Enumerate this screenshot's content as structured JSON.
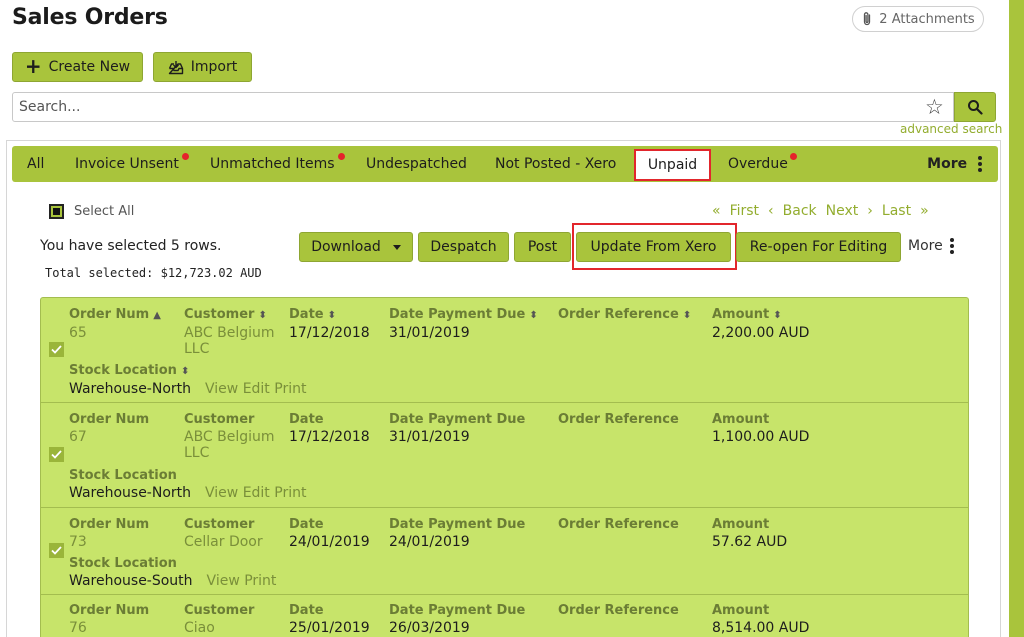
{
  "page": {
    "title": "Sales Orders",
    "attachments_label": "2 Attachments"
  },
  "toolbar": {
    "create_label": "Create New",
    "import_label": "Import"
  },
  "search": {
    "placeholder": "Search...",
    "advanced_label": "advanced search"
  },
  "tabs": [
    {
      "label": "All",
      "dot": false
    },
    {
      "label": "Invoice Unsent",
      "dot": true
    },
    {
      "label": "Unmatched Items",
      "dot": true
    },
    {
      "label": "Undespatched",
      "dot": false
    },
    {
      "label": "Not Posted - Xero",
      "dot": false
    },
    {
      "label": "Unpaid",
      "dot": false,
      "active": true
    },
    {
      "label": "Overdue",
      "dot": true
    }
  ],
  "tabs_more_label": "More",
  "list": {
    "select_all_label": "Select All",
    "pager": {
      "first": "First",
      "back": "Back",
      "next": "Next",
      "last": "Last"
    },
    "selected_text": "You have selected 5 rows.",
    "total_text": "Total selected: $12,723.02 AUD"
  },
  "actions": {
    "download": "Download",
    "despatch": "Despatch",
    "post": "Post",
    "update_xero": "Update From Xero",
    "reopen": "Re-open For Editing",
    "more": "More"
  },
  "columns": {
    "order_num": "Order Num",
    "customer": "Customer",
    "date": "Date",
    "date_payment_due": "Date Payment Due",
    "order_reference": "Order Reference",
    "amount": "Amount",
    "stock_location": "Stock Location"
  },
  "orders": [
    {
      "order_num": "65",
      "customer": "ABC Belgium LLC",
      "date": "17/12/2018",
      "due": "31/01/2019",
      "reference": "",
      "amount": "2,200.00 AUD",
      "location": "Warehouse-North",
      "links": "View Edit Print",
      "checked": true
    },
    {
      "order_num": "67",
      "customer": "ABC Belgium LLC",
      "date": "17/12/2018",
      "due": "31/01/2019",
      "reference": "",
      "amount": "1,100.00 AUD",
      "location": "Warehouse-North",
      "links": "View Edit Print",
      "checked": true
    },
    {
      "order_num": "73",
      "customer": "Cellar Door",
      "date": "24/01/2019",
      "due": "24/01/2019",
      "reference": "",
      "amount": "57.62 AUD",
      "location": "Warehouse-South",
      "links": "View Print",
      "checked": true
    },
    {
      "order_num": "76",
      "customer": "Ciao",
      "date": "25/01/2019",
      "due": "26/03/2019",
      "reference": "",
      "amount": "8,514.00 AUD",
      "location": "",
      "links": "",
      "checked": true
    }
  ],
  "colors": {
    "accent": "#a9c43c",
    "row_bg": "#c7e46a",
    "highlight": "#e2262c",
    "link": "#93ad2f"
  }
}
